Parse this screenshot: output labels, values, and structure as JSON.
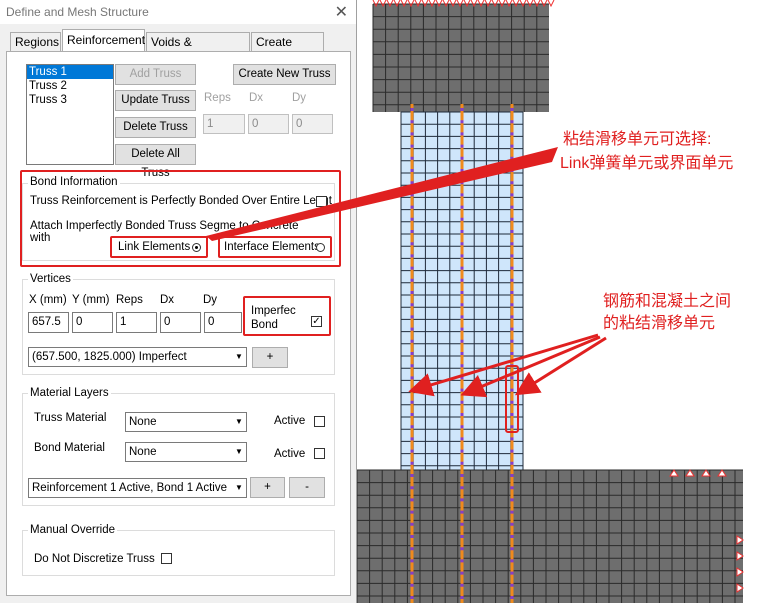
{
  "window": {
    "title": "Define and Mesh Structure",
    "close_glyph": "✕"
  },
  "tabs": [
    {
      "label": "Regions"
    },
    {
      "label": "Reinforcement"
    },
    {
      "label": "Voids & Constraints"
    },
    {
      "label": "Create Mesh"
    }
  ],
  "truss_list": [
    "Truss 1",
    "Truss 2",
    "Truss 3"
  ],
  "buttons": {
    "add_truss": "Add Truss",
    "create_new_truss": "Create New Truss",
    "update_truss": "Update Truss",
    "delete_truss": "Delete Truss",
    "delete_all_truss": "Delete  All Truss"
  },
  "truss_params": {
    "reps_label": "Reps",
    "dx_label": "Dx",
    "dy_label": "Dy",
    "reps_value": "1",
    "dx_value": "0",
    "dy_value": "0"
  },
  "bond": {
    "group_label": "Bond Information",
    "perfect_label": "Truss Reinforcement is Perfectly Bonded Over Entire Lengt",
    "attach_label_line1": "Attach Imperfectly Bonded Truss Segme   to Concrete",
    "attach_label_line2": "with",
    "link_label": "Link Elements",
    "interface_label": "Interface Elements"
  },
  "vertices": {
    "group_label": "Vertices",
    "x_label": "X (mm)",
    "y_label": "Y (mm)",
    "reps_label": "Reps",
    "dx_label": "Dx",
    "dy_label": "Dy",
    "x_value": "657.5",
    "y_value": "0",
    "reps_value": "1",
    "dx_value": "0",
    "dy_value": "0",
    "imperfect_label_line1": "Imperfec",
    "imperfect_label_line2": "Bond",
    "imperfect_checked_glyph": "✓",
    "vertex_select": "(657.500, 1825.000) Imperfect",
    "add_label": "+"
  },
  "material": {
    "group_label": "Material Layers",
    "truss_label": "Truss Material",
    "truss_value": "None",
    "bond_label": "Bond Material",
    "bond_value": "None",
    "active_label": "Active",
    "layer_select": "Reinforcement 1 Active, Bond 1 Active",
    "plus_label": "+",
    "minus_label": "-"
  },
  "override": {
    "group_label": "Manual Override",
    "discretize_label": "Do Not Discretize Truss"
  },
  "annotations": {
    "bond_slip_line1": "粘结滑移单元可选择:",
    "bond_slip_line2": "Link弹簧单元或界面单元",
    "steel_concrete_line1": "钢筋和混凝土之间",
    "steel_concrete_line2": "的粘结滑移单元"
  },
  "colors": {
    "annotation_red": "#e02020",
    "concrete_gray": "#6e6e6e",
    "column_blue": "#cfe6fb",
    "rebar_orange": "#f08a1c",
    "link_purple": "#8a3cc8",
    "selection_blue": "#0078d7"
  }
}
